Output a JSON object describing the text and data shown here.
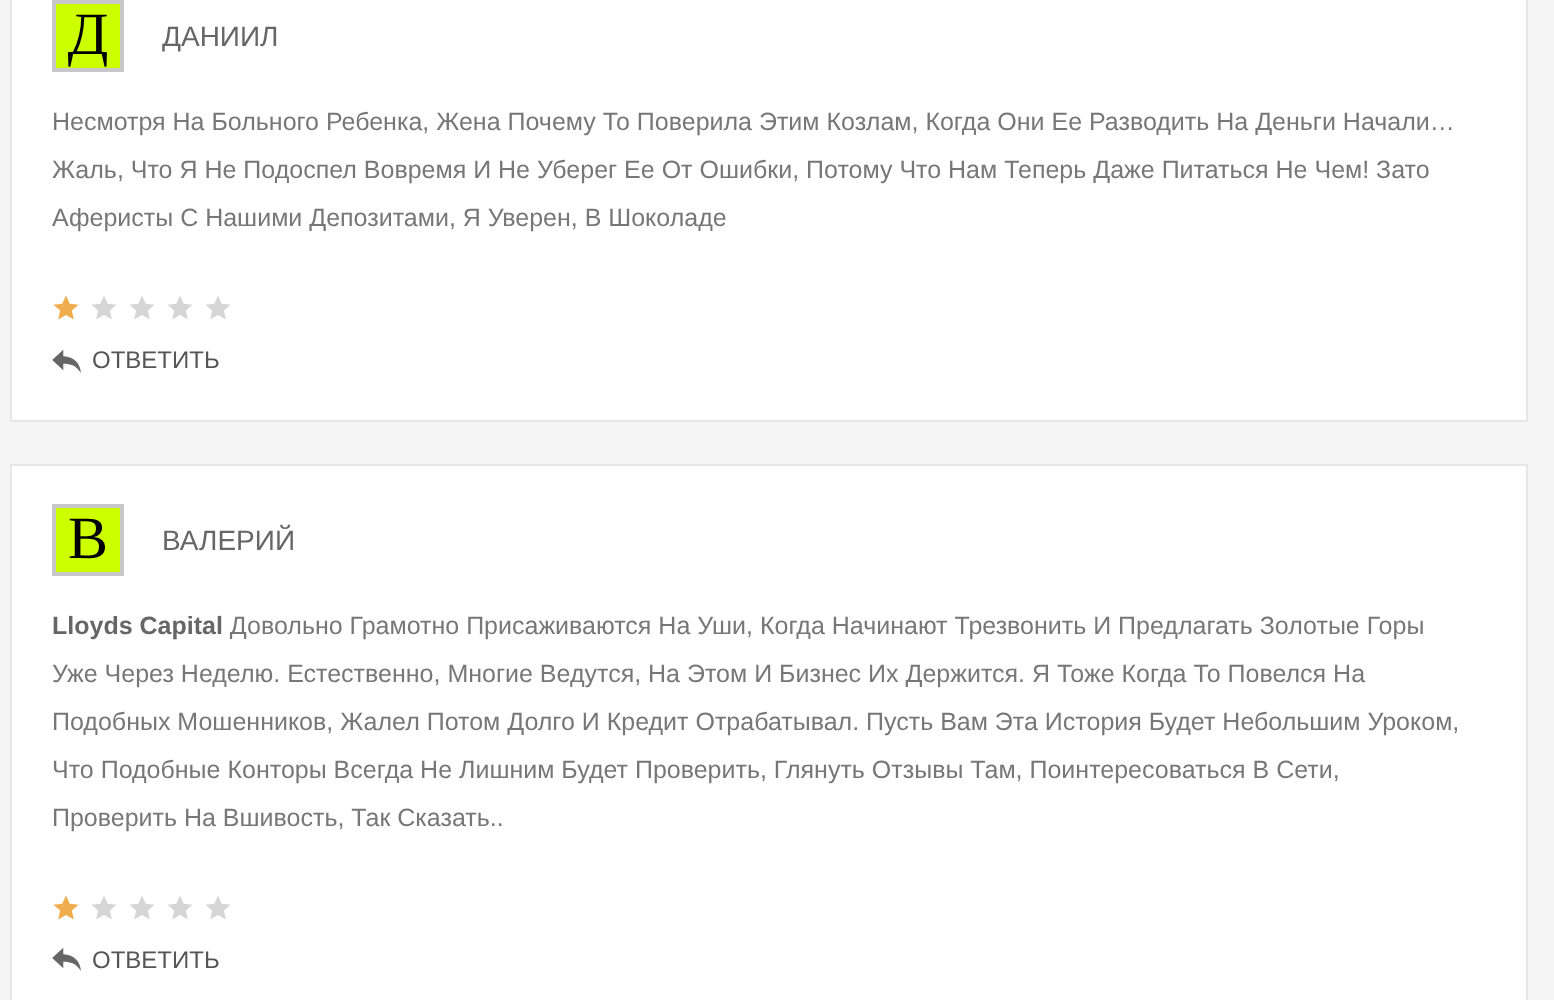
{
  "reviews": [
    {
      "initial": "Д",
      "name": "ДАНИИЛ",
      "text": "Несмотря На Больного Ребенка, Жена Почему То Поверила Этим Козлам, Когда Они Ее Разводить На Деньги Начали… Жаль, Что Я Не Подоспел Вовремя И Не Уберег Ее От Ошибки, Потому Что Нам Теперь Даже Питаться Не Чем! Зато Аферисты С Нашими Депозитами, Я Уверен, В Шоколаде",
      "stars": 1,
      "reply": "ОТВЕТИТЬ"
    },
    {
      "initial": "В",
      "name": "ВАЛЕРИЙ",
      "text": "**Lloyds Capital** Довольно Грамотно Присаживаются На Уши, Когда Начинают Трезвонить И Предлагать Золотые Горы Уже Через Неделю. Естественно, Многие Ведутся, На Этом И Бизнес Их Держится. Я Тоже Когда То Повелся На Подобных Мошенников, Жалел Потом Долго И Кредит Отрабатывал. Пусть Вам Эта История Будет Небольшим Уроком, Что Подобные Конторы Всегда Не Лишним Будет Проверить, Глянуть Отзывы Там, Поинтересоваться В Сети, Проверить На Вшивость, Так Сказать..",
      "stars": 1,
      "reply": "ОТВЕТИТЬ"
    }
  ]
}
